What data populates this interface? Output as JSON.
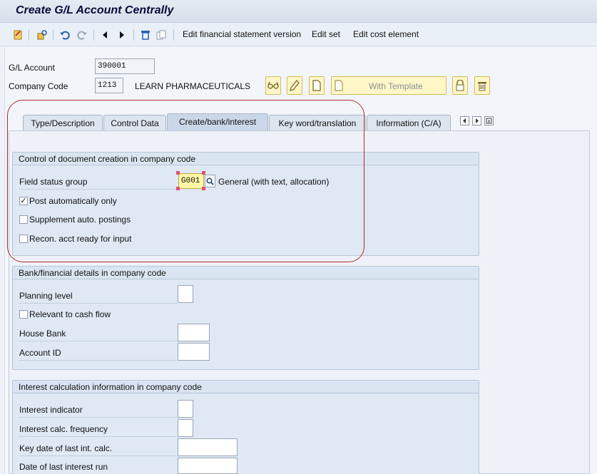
{
  "window": {
    "title": "Create G/L Account Centrally"
  },
  "toolbar": {
    "icons": [
      "display-change-icon",
      "where-used-icon",
      "undo-icon",
      "redo-icon",
      "previous-icon",
      "next-icon",
      "delete-icon",
      "copy-icon"
    ],
    "edit_fs_version": "Edit financial statement version",
    "edit_set": "Edit set",
    "edit_cost_element": "Edit cost element"
  },
  "header": {
    "gl_account_label": "G/L Account",
    "gl_account_value": "390001",
    "company_code_label": "Company Code",
    "company_code_value": "1213",
    "company_name": "LEARN PHARMACEUTICALS",
    "with_template": "With Template"
  },
  "tabs": [
    {
      "label": "Type/Description",
      "active": false
    },
    {
      "label": "Control Data",
      "active": false
    },
    {
      "label": "Create/bank/interest",
      "active": true
    },
    {
      "label": "Key word/translation",
      "active": false
    },
    {
      "label": "Information (C/A)",
      "active": false
    }
  ],
  "group_doc_creation": {
    "title": "Control of document creation in company code",
    "field_status_group_label": "Field status group",
    "field_status_group_value": "G001",
    "field_status_group_desc": "General (with text, allocation)",
    "post_auto_label": "Post automatically only",
    "post_auto_checked": true,
    "supplement_label": "Supplement auto. postings",
    "supplement_checked": false,
    "recon_label": "Recon. acct ready for input",
    "recon_checked": false
  },
  "group_bank": {
    "title": "Bank/financial details in company code",
    "planning_level_label": "Planning level",
    "cash_flow_label": "Relevant to cash flow",
    "cash_flow_checked": false,
    "house_bank_label": "House Bank",
    "account_id_label": "Account ID"
  },
  "group_interest": {
    "title": "Interest calculation information in company code",
    "interest_indicator_label": "Interest indicator",
    "calc_frequency_label": "Interest calc. frequency",
    "key_date_label": "Key date of last int. calc.",
    "last_run_label": "Date of last interest run"
  },
  "colors": {
    "annotation": "#b22a2a",
    "highlight": "#fff7a6",
    "accent": "#d5bb57"
  }
}
